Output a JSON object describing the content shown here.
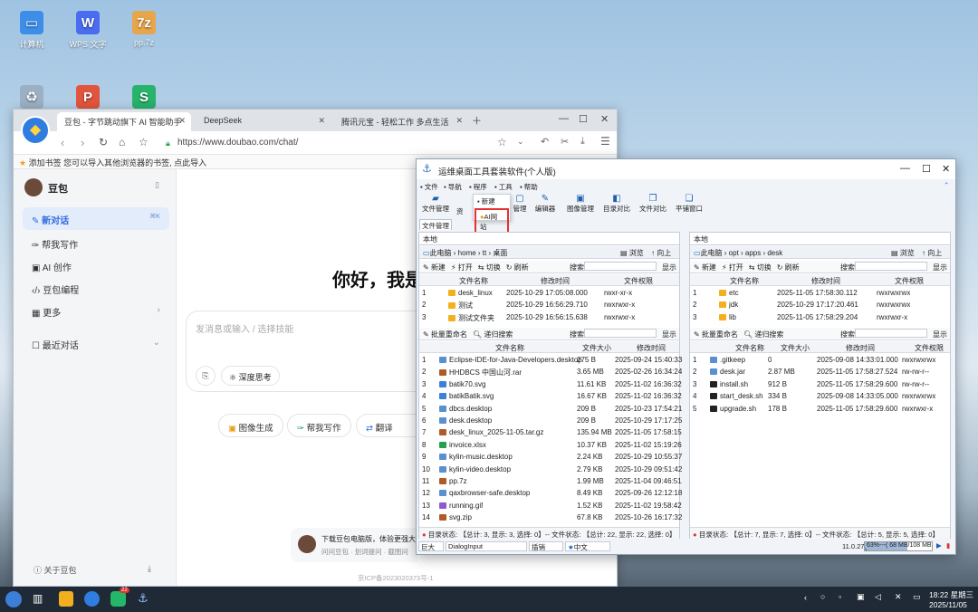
{
  "desktop": {
    "icons": [
      {
        "label": "计算机",
        "icon": "computer-icon",
        "color": "#3d8ee8"
      },
      {
        "label": "WPS 文字",
        "icon": "wps-writer-icon",
        "color": "#4a6cf0"
      },
      {
        "label": "pp.7z",
        "icon": "archive-icon",
        "color": "#e8a64a"
      },
      {
        "label": "",
        "icon": "trash-icon",
        "color": "#9bb0c4"
      },
      {
        "label": "",
        "icon": "wps-presentation-icon",
        "color": "#e2543d"
      },
      {
        "label": "",
        "icon": "wps-spreadsheet-icon",
        "color": "#27b36b"
      }
    ]
  },
  "browser": {
    "tabs": [
      "豆包 - 字节跳动旗下 AI 智能助手",
      "DeepSeek",
      "腾讯元宝 - 轻松工作 多点生活"
    ],
    "url": "https://www.doubao.com/chat/",
    "bookmark_hint": "添加书签  您可以导入其他浏览器的书签, 点此导入",
    "app_name": "豆包",
    "nav": [
      "新对话",
      "帮我写作",
      "AI 创作",
      "豆包编程",
      "更多",
      "最近对话"
    ],
    "greeting": "你好，我是",
    "input_placeholder": "发消息或输入 / 选择技能",
    "deep_think": "深度思考",
    "pills": [
      "图像生成",
      "帮我写作",
      "翻译"
    ],
    "download_title": "下载豆包电脑版，体验更强大的",
    "download_links": "问问豆包 · 划词提问 · 截图问",
    "about": "关于豆包",
    "icp": "京ICP备2023020373号-1",
    "accent": "#2f6ae1"
  },
  "tool": {
    "title": "运维桌面工具套装软件(个人版)",
    "menu": [
      "文件",
      "导航",
      "程序",
      "工具",
      "帮助"
    ],
    "dropdown": [
      "新建",
      "AI网站"
    ],
    "toolbar": [
      "文件管理",
      "资",
      "管理",
      "编辑器",
      "图像管理",
      "目录对比",
      "文件对比",
      "平铺窗口"
    ],
    "group_tab": "文件管理",
    "local_label": "本地",
    "left": {
      "path": "此电脑 › home › tt › 桌面",
      "browse": "浏览",
      "up": "向上",
      "actions": [
        "新建",
        "打开",
        "切换",
        "刷新"
      ],
      "search": "搜索",
      "show": "显示",
      "headers": [
        "文件名称",
        "修改时间",
        "文件权限"
      ],
      "dirs": [
        [
          "1",
          "desk_linux",
          "2025-10-29 17:05:08.000",
          "rwxr-xr-x"
        ],
        [
          "2",
          "测试",
          "2025-10-29 16:56:29.710",
          "rwxrwxr-x"
        ],
        [
          "3",
          "测试文件夹",
          "2025-10-29 16:56:15.638",
          "rwxrwxr-x"
        ]
      ],
      "rename": "批量重命名",
      "advsearch": "递归搜索",
      "fheaders": [
        "文件名称",
        "文件大小",
        "修改时间"
      ],
      "files": [
        [
          "1",
          "Eclipse-IDE-for-Java-Developers.desktop",
          "275 B",
          "2025-09-24 15:40:33"
        ],
        [
          "2",
          "HHDBCS 中国山河.rar",
          "3.65 MB",
          "2025-02-26 16:34:24"
        ],
        [
          "3",
          "batik70.svg",
          "11.61 KB",
          "2025-11-02 16:36:32"
        ],
        [
          "4",
          "batikBatik.svg",
          "16.67 KB",
          "2025-11-02 16:36:32"
        ],
        [
          "5",
          "dbcs.desktop",
          "209 B",
          "2025-10-23 17:54:21"
        ],
        [
          "6",
          "desk.desktop",
          "209 B",
          "2025-10-29 17:17:25"
        ],
        [
          "7",
          "desk_linux_2025-11-05.tar.gz",
          "135.94 MB",
          "2025-11-05 17:58:15"
        ],
        [
          "8",
          "invoice.xlsx",
          "10.37 KB",
          "2025-11-02 15:19:26"
        ],
        [
          "9",
          "kylin-music.desktop",
          "2.24 KB",
          "2025-10-29 10:55:37"
        ],
        [
          "10",
          "kylin-video.desktop",
          "2.79 KB",
          "2025-10-29 09:51:42"
        ],
        [
          "11",
          "pp.7z",
          "1.99 MB",
          "2025-11-04 09:46:51"
        ],
        [
          "12",
          "qaxbrowser-safe.desktop",
          "8.49 KB",
          "2025-09-26 12:12:18"
        ],
        [
          "13",
          "running.gif",
          "1.52 KB",
          "2025-11-02 19:58:42"
        ],
        [
          "14",
          "svg.zip",
          "67.8 KB",
          "2025-10-26 16:17:32"
        ]
      ],
      "status": "目录状态: 【总计: 3, 显示: 3, 选择: 0】-- 文件状态: 【总计: 22, 显示: 22, 选择: 0】"
    },
    "right": {
      "path": "此电脑 › opt › apps › desk",
      "browse": "浏览",
      "up": "向上",
      "actions": [
        "新建",
        "打开",
        "切换",
        "刷新"
      ],
      "search": "搜索",
      "show": "显示",
      "headers": [
        "文件名称",
        "修改时间",
        "文件权限"
      ],
      "dirs": [
        [
          "1",
          "etc",
          "2025-11-05 17:58:30.112",
          "rwxrwxrwx"
        ],
        [
          "2",
          "jdk",
          "2025-10-29 17:17:20.461",
          "rwxrwxrwx"
        ],
        [
          "3",
          "lib",
          "2025-11-05 17:58:29.204",
          "rwxrwxr-x"
        ]
      ],
      "rename": "批量重命名",
      "advsearch": "递归搜索",
      "fheaders": [
        "文件名称",
        "文件大小",
        "修改时间",
        "文件权限"
      ],
      "files": [
        [
          "1",
          ".gitkeep",
          "0",
          "2025-09-08 14:33:01.000",
          "rwxrwxrwx"
        ],
        [
          "2",
          "desk.jar",
          "2.87 MB",
          "2025-11-05 17:58:27.524",
          "rw-rw-r--"
        ],
        [
          "3",
          "install.sh",
          "912 B",
          "2025-11-05 17:58:29.600",
          "rw-rw-r--"
        ],
        [
          "4",
          "start_desk.sh",
          "334 B",
          "2025-09-08 14:33:05.000",
          "rwxrwxrwx"
        ],
        [
          "5",
          "upgrade.sh",
          "178 B",
          "2025-11-05 17:58:29.600",
          "rwxrwxr-x"
        ]
      ],
      "status": "目录状态: 【总计: 7, 显示: 7, 选择: 0】-- 文件状态: 【总计: 5, 显示: 5, 选择: 0】"
    },
    "bottom": {
      "size": "巨大",
      "font": "DialogInput",
      "cursor": "插销",
      "lang": "中文",
      "version": "11.0.27",
      "memory": "63%---( 68 MB/108 MB )"
    }
  },
  "taskbar": {
    "badge": "22",
    "time": "18:22 星期三",
    "date": "2025/11/05"
  }
}
